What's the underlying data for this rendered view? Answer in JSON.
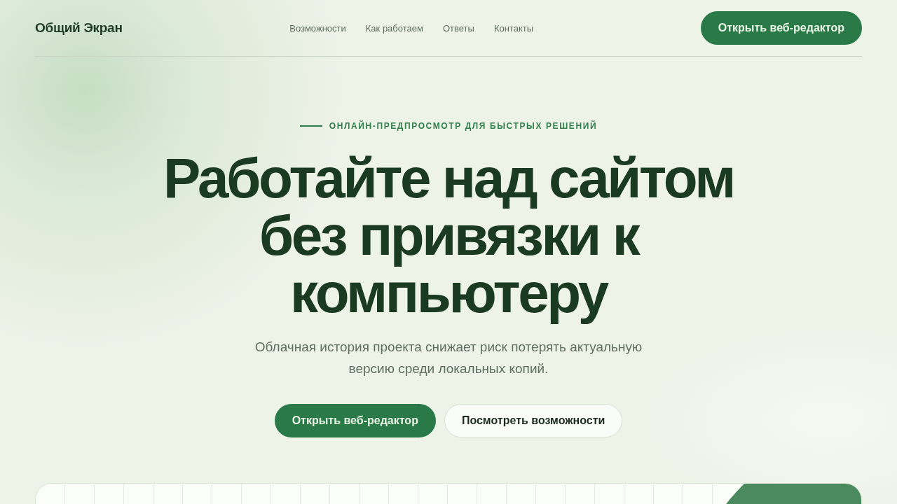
{
  "header": {
    "logo": "Общий Экран",
    "nav": [
      "Возможности",
      "Как работаем",
      "Ответы",
      "Контакты"
    ],
    "cta": "Открыть веб-редактор"
  },
  "hero": {
    "eyebrow": "ОНЛАЙН-ПРЕДПРОСМОТР ДЛЯ БЫСТРЫХ РЕШЕНИЙ",
    "title": "Работайте над сайтом без привязки к компьютеру",
    "subtitle": "Облачная история проекта снижает риск потерять актуальную версию среди локальных копий.",
    "buttons": [
      {
        "label": "Открыть веб-редактор",
        "kind": "primary"
      },
      {
        "label": "Посмотреть возможности",
        "kind": "secondary"
      }
    ]
  }
}
